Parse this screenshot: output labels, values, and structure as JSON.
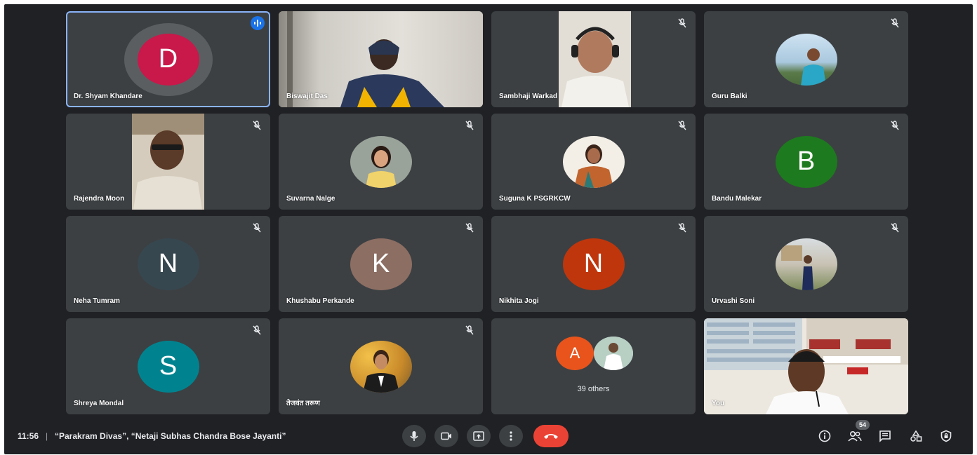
{
  "participants": [
    {
      "name": "Dr. Shyam Khandare",
      "initial": "D",
      "color": "#c9184a",
      "speaking": true
    },
    {
      "name": "Biswajit Das"
    },
    {
      "name": "Sambhaji Warkad"
    },
    {
      "name": "Guru Balki"
    },
    {
      "name": "Rajendra Moon"
    },
    {
      "name": "Suvarna Nalge"
    },
    {
      "name": "Suguna K PSGRKCW"
    },
    {
      "name": "Bandu Malekar",
      "initial": "B",
      "color": "#1e7a1e"
    },
    {
      "name": "Neha Tumram",
      "initial": "N",
      "color": "#37474f"
    },
    {
      "name": "Khushabu Perkande",
      "initial": "K",
      "color": "#8d6e63"
    },
    {
      "name": "Nikhita Jogi",
      "initial": "N",
      "color": "#bf360c"
    },
    {
      "name": "Urvashi Soni"
    },
    {
      "name": "Shreya Mondal",
      "initial": "S",
      "color": "#00838f"
    },
    {
      "name": "तेजवंत तरूण"
    },
    {
      "others_initial": "A",
      "others_label": "39 others"
    },
    {
      "name": "You"
    }
  ],
  "bottom_bar": {
    "time": "11:56",
    "separator": "|",
    "meeting_title": "“Parakram Divas”, “Netaji Subhas Chandra Bose Jayanti”",
    "people_count": "54"
  },
  "icons": {
    "controls": [
      "microphone-icon",
      "camera-icon",
      "present-screen-icon",
      "more-options-icon",
      "end-call-icon"
    ],
    "right": [
      "info-icon",
      "people-icon",
      "chat-icon",
      "activities-icon",
      "host-controls-icon"
    ]
  },
  "colors": {
    "background": "#202124",
    "tile": "#3c4043",
    "end_call": "#ea4335",
    "speaking_outline": "#8ab4f8",
    "others_avatar": "#e8541c"
  }
}
